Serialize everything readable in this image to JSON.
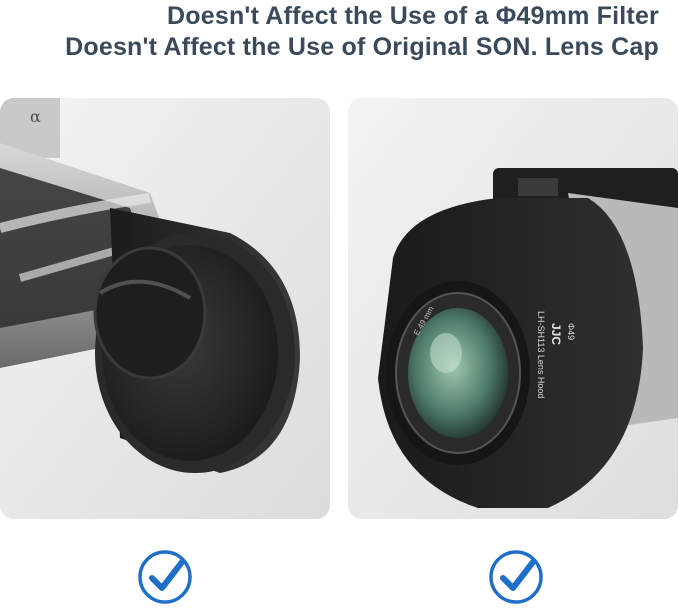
{
  "headlines": {
    "line1": "Doesn't Affect the Use of a Φ49mm Filter",
    "line2": "Doesn't Affect the Use of Original SON. Lens Cap"
  },
  "left_photo": {
    "camera_badge": "α"
  },
  "right_photo": {
    "brand": "JJC",
    "model": "LH-SH113 Lens Hood",
    "filter_size": "Φ49",
    "lens_text": "E 49 mm"
  },
  "colors": {
    "headline": "#3a4a5a",
    "check_accent": "#1f6fc9"
  },
  "icons": [
    "check-circle-icon",
    "check-circle-icon"
  ]
}
